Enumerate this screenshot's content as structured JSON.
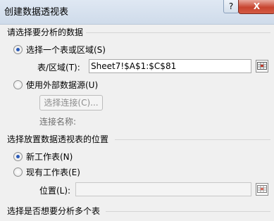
{
  "window": {
    "title": "创建数据透视表",
    "help_label": "?",
    "close_label": "X"
  },
  "section1": {
    "title": "请选择要分析的数据",
    "option_select_range": "选择一个表或区域(S)",
    "table_range_label": "表/区域(T):",
    "table_range_value": "Sheet7!$A$1:$C$81",
    "option_external": "使用外部数据源(U)",
    "choose_connection_button": "选择连接(C)...",
    "connection_name_label": "连接名称:"
  },
  "section2": {
    "title": "选择放置数据透视表的位置",
    "option_new_sheet": "新工作表(N)",
    "option_existing_sheet": "现有工作表(E)",
    "location_label": "位置(L):",
    "location_value": ""
  },
  "section3": {
    "title": "选择是否想要分析多个表"
  },
  "icons": {
    "range_picker": "range-picker-icon"
  }
}
